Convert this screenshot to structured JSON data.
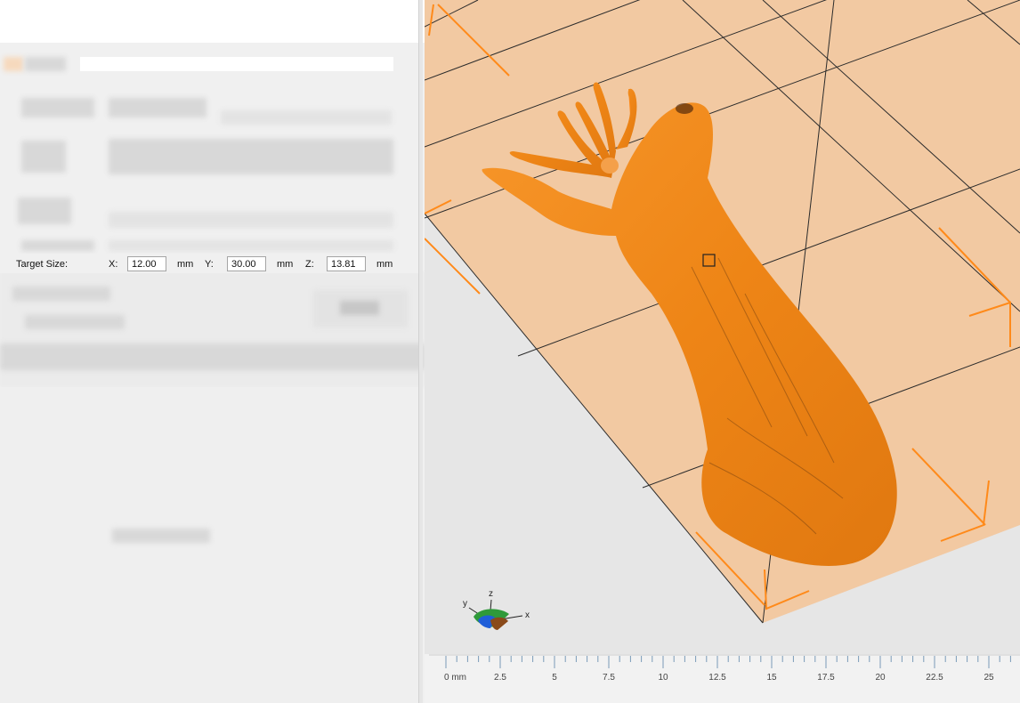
{
  "target_size": {
    "label": "Target Size:",
    "x_label": "X:",
    "x_value": "12.00",
    "y_label": "Y:",
    "y_value": "30.00",
    "z_label": "Z:",
    "z_value": "13.81",
    "unit": "mm"
  },
  "axis_gizmo": {
    "x": "x",
    "y": "y",
    "z": "z"
  },
  "ruler": {
    "labels": [
      "0 mm",
      "2.5",
      "5",
      "7.5",
      "10",
      "12.5",
      "15",
      "17.5",
      "20",
      "22.5",
      "25"
    ]
  },
  "colors": {
    "model": "#f08a1e",
    "bed": "#f2c79e",
    "bed_edge": "#ff8a1a",
    "background": "#e6e6e6"
  },
  "icons": [
    "axis-gizmo-icon"
  ]
}
